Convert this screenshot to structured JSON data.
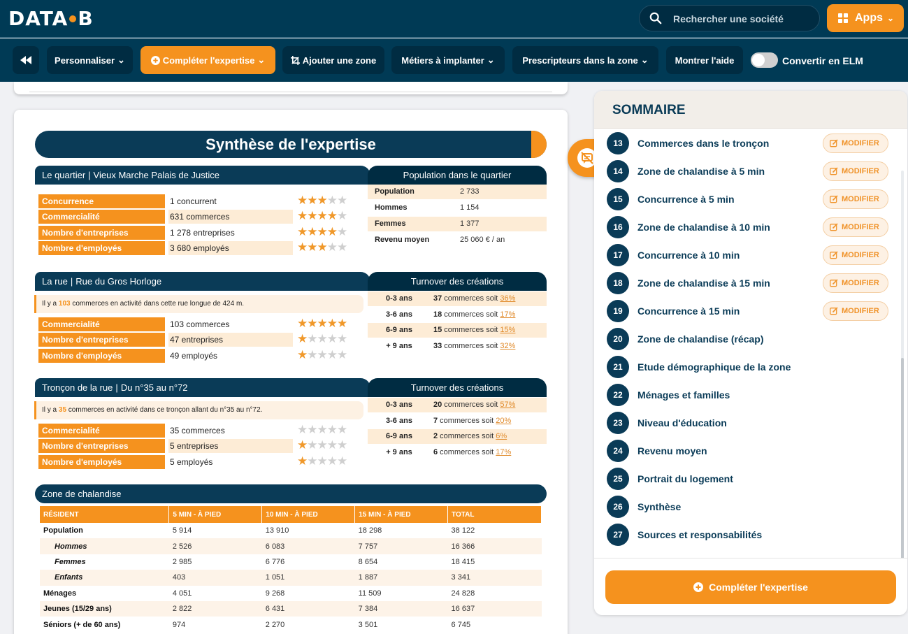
{
  "brand": {
    "logo_left": "DATA",
    "logo_right": "B",
    "accent": "#f5921e",
    "primary": "#0a3b57"
  },
  "search": {
    "placeholder": "Rechercher une société"
  },
  "apps": {
    "label": "Apps"
  },
  "toolbar": {
    "personaliser": "Personnaliser",
    "completer": "Compléter l'expertise",
    "ajouter_zone": "Ajouter une zone",
    "metiers": "Métiers à implanter",
    "prescripteurs": "Prescripteurs dans la zone",
    "aide": "Montrer l'aide",
    "convertir": "Convertir en ELM"
  },
  "synthese": {
    "title": "Synthèse de l'expertise",
    "quartier": {
      "head_label": "Le quartier",
      "head_value": "Vieux Marche Palais de Justice",
      "rows": [
        {
          "label": "Concurrence",
          "value": "1 concurrent",
          "stars": 3
        },
        {
          "label": "Commercialité",
          "value": "631 commerces",
          "stars": 4
        },
        {
          "label": "Nombre d'entreprises",
          "value": "1 278 entreprises",
          "stars": 4
        },
        {
          "label": "Nombre d'employés",
          "value": "3 680 employés",
          "stars": 3
        }
      ],
      "pop_title": "Population dans le quartier",
      "pop": [
        {
          "k": "Population",
          "v": "2 733"
        },
        {
          "k": "Hommes",
          "v": "1 154"
        },
        {
          "k": "Femmes",
          "v": "1 377"
        },
        {
          "k": "Revenu moyen",
          "v": "25 060 € / an"
        }
      ]
    },
    "rue": {
      "head_label": "La rue",
      "head_value": "Rue du Gros Horloge",
      "info_pre": "Il y a ",
      "info_num": "103",
      "info_post": " commerces en activité dans cette rue longue de 424 m.",
      "rows": [
        {
          "label": "Commercialité",
          "value": "103 commerces",
          "stars": 5
        },
        {
          "label": "Nombre d'entreprises",
          "value": "47 entreprises",
          "stars": 1
        },
        {
          "label": "Nombre d'employés",
          "value": "49 employés",
          "stars": 1
        }
      ],
      "turn_title": "Turnover des créations",
      "turnover": [
        {
          "k": "0-3 ans",
          "n": "37",
          "t": " commerces soit ",
          "p": "36%"
        },
        {
          "k": "3-6 ans",
          "n": "18",
          "t": " commerces soit ",
          "p": "17%"
        },
        {
          "k": "6-9 ans",
          "n": "15",
          "t": " commerces soit ",
          "p": "15%"
        },
        {
          "k": "+ 9 ans",
          "n": "33",
          "t": " commerces soit ",
          "p": "32%"
        }
      ]
    },
    "troncon": {
      "head_label": "Tronçon de la rue",
      "head_value": "Du n°35 au n°72",
      "info_pre": "Il y a ",
      "info_num": "35",
      "info_post": " commerces en activité dans ce tronçon allant du n°35 au n°72.",
      "rows": [
        {
          "label": "Commercialité",
          "value": "35 commerces",
          "stars": 0
        },
        {
          "label": "Nombre d'entreprises",
          "value": "5 entreprises",
          "stars": 1
        },
        {
          "label": "Nombre d'employés",
          "value": "5 employés",
          "stars": 1
        }
      ],
      "turn_title": "Turnover des créations",
      "turnover": [
        {
          "k": "0-3 ans",
          "n": "20",
          "t": " commerces soit ",
          "p": "57%"
        },
        {
          "k": "3-6 ans",
          "n": "7",
          "t": " commerces soit ",
          "p": "20%"
        },
        {
          "k": "6-9 ans",
          "n": "2",
          "t": " commerces soit ",
          "p": "6%"
        },
        {
          "k": "+ 9 ans",
          "n": "6",
          "t": " commerces soit ",
          "p": "17%"
        }
      ]
    },
    "zone": {
      "head_label": "Zone de chalandise",
      "columns": [
        "RÉSIDENT",
        "5 MIN - À PIED",
        "10 MIN - À PIED",
        "15 MIN - À PIED",
        "TOTAL"
      ],
      "rows": [
        {
          "k": "Population",
          "sub": false,
          "v": [
            "5 914",
            "13 910",
            "18 298",
            "38 122"
          ]
        },
        {
          "k": "Hommes",
          "sub": true,
          "v": [
            "2 526",
            "6 083",
            "7 757",
            "16 366"
          ]
        },
        {
          "k": "Femmes",
          "sub": true,
          "v": [
            "2 985",
            "6 776",
            "8 654",
            "18 415"
          ]
        },
        {
          "k": "Enfants",
          "sub": true,
          "v": [
            "403",
            "1 051",
            "1 887",
            "3 341"
          ]
        },
        {
          "k": "Ménages",
          "sub": false,
          "v": [
            "4 051",
            "9 268",
            "11 509",
            "24 828"
          ]
        },
        {
          "k": "Jeunes (15/29 ans)",
          "sub": false,
          "v": [
            "2 822",
            "6 431",
            "7 384",
            "16 637"
          ]
        },
        {
          "k": "Séniors (+ de 60 ans)",
          "sub": false,
          "v": [
            "974",
            "2 270",
            "3 501",
            "6 745"
          ]
        }
      ]
    }
  },
  "sommaire": {
    "title": "SOMMAIRE",
    "modify_label": "MODIFIER",
    "items": [
      {
        "n": "13",
        "label": "Commerces dans le tronçon",
        "editable": true
      },
      {
        "n": "14",
        "label": "Zone de chalandise à 5 min",
        "editable": true
      },
      {
        "n": "15",
        "label": "Concurrence à 5 min",
        "editable": true
      },
      {
        "n": "16",
        "label": "Zone de chalandise à 10 min",
        "editable": true
      },
      {
        "n": "17",
        "label": "Concurrence à 10 min",
        "editable": true
      },
      {
        "n": "18",
        "label": "Zone de chalandise à 15 min",
        "editable": true
      },
      {
        "n": "19",
        "label": "Concurrence à 15 min",
        "editable": true
      },
      {
        "n": "20",
        "label": "Zone de chalandise (récap)",
        "editable": false
      },
      {
        "n": "21",
        "label": "Etude démographique de la zone",
        "editable": false
      },
      {
        "n": "22",
        "label": "Ménages et familles",
        "editable": false
      },
      {
        "n": "23",
        "label": "Niveau d'éducation",
        "editable": false
      },
      {
        "n": "24",
        "label": "Revenu moyen",
        "editable": false
      },
      {
        "n": "25",
        "label": "Portrait du logement",
        "editable": false
      },
      {
        "n": "26",
        "label": "Synthèse",
        "editable": false
      },
      {
        "n": "27",
        "label": "Sources et responsabilités",
        "editable": false
      }
    ],
    "cta": "Compléter l'expertise"
  }
}
